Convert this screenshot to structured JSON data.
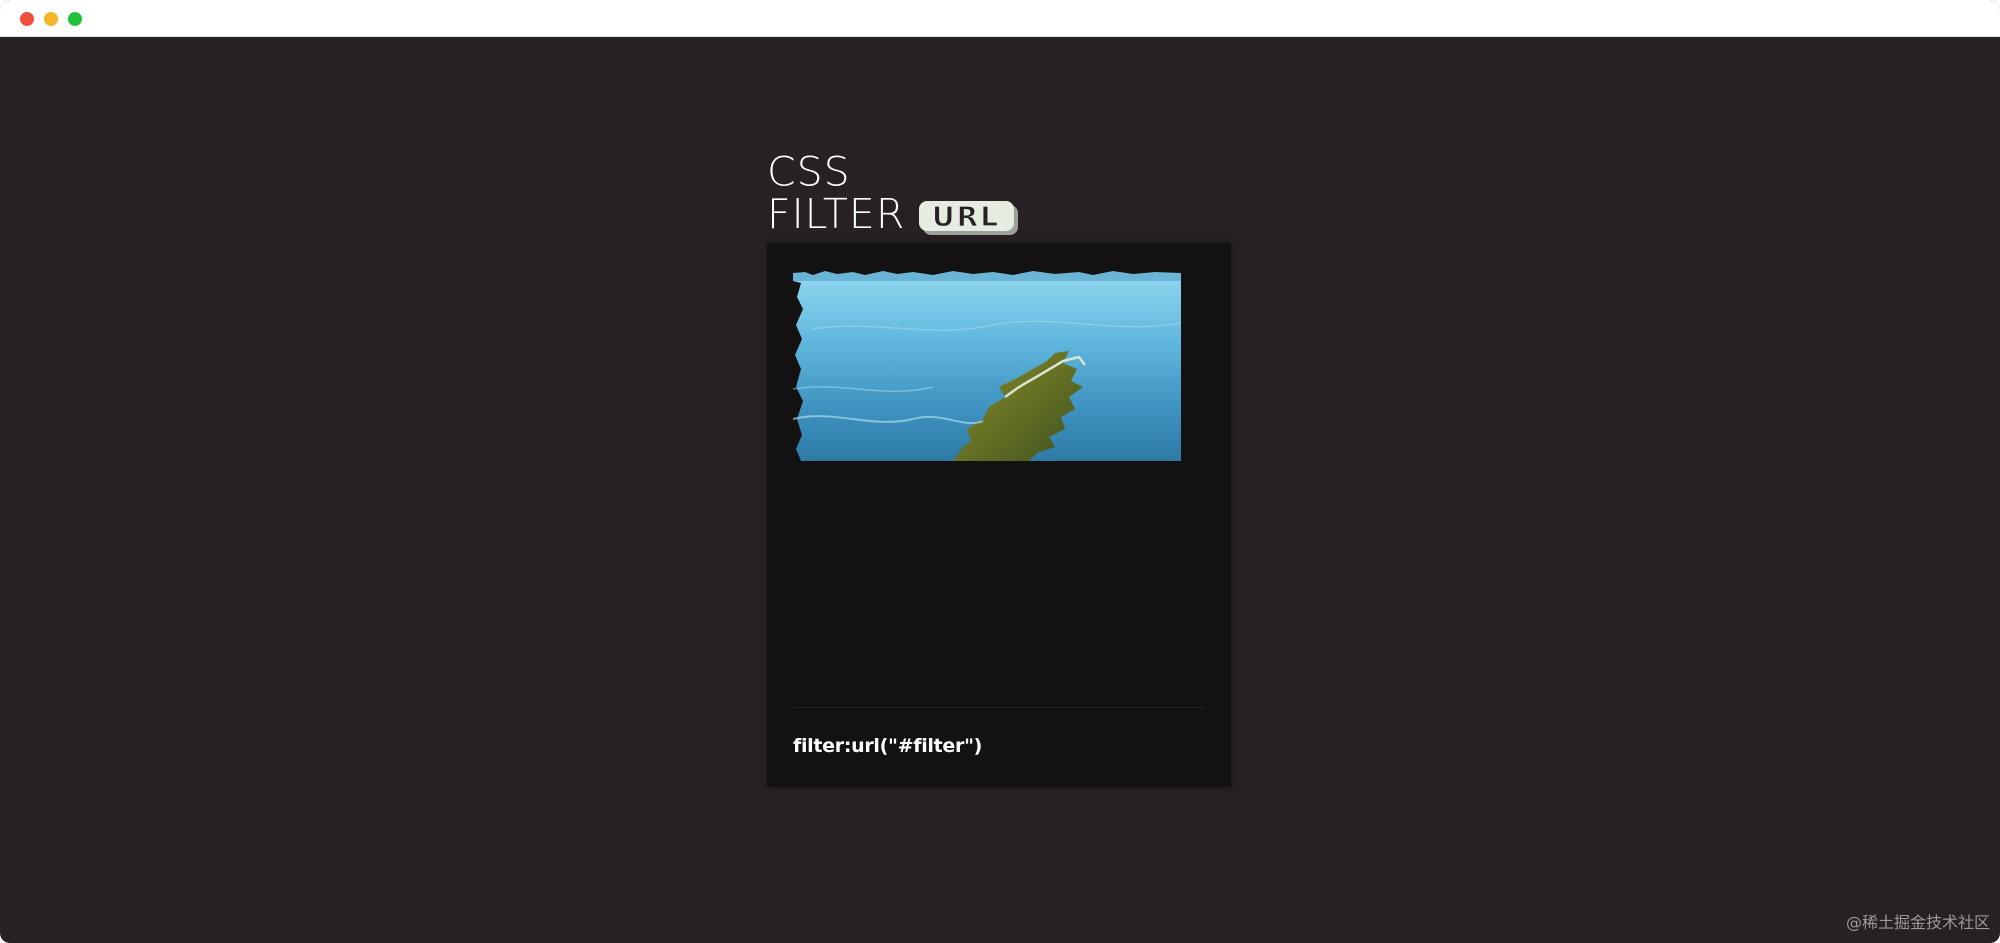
{
  "heading": {
    "line1": "CSS",
    "line2": "FILTER",
    "badge": "URL"
  },
  "card": {
    "image_alt": "water photo distorted by svg filter",
    "caption": "filter:url(\"#filter\")"
  },
  "watermark": "@稀土掘金技术社区",
  "colors": {
    "background": "#272124",
    "card": "#141112",
    "text": "#ffffff",
    "badge_fill": "#e6ece2"
  }
}
